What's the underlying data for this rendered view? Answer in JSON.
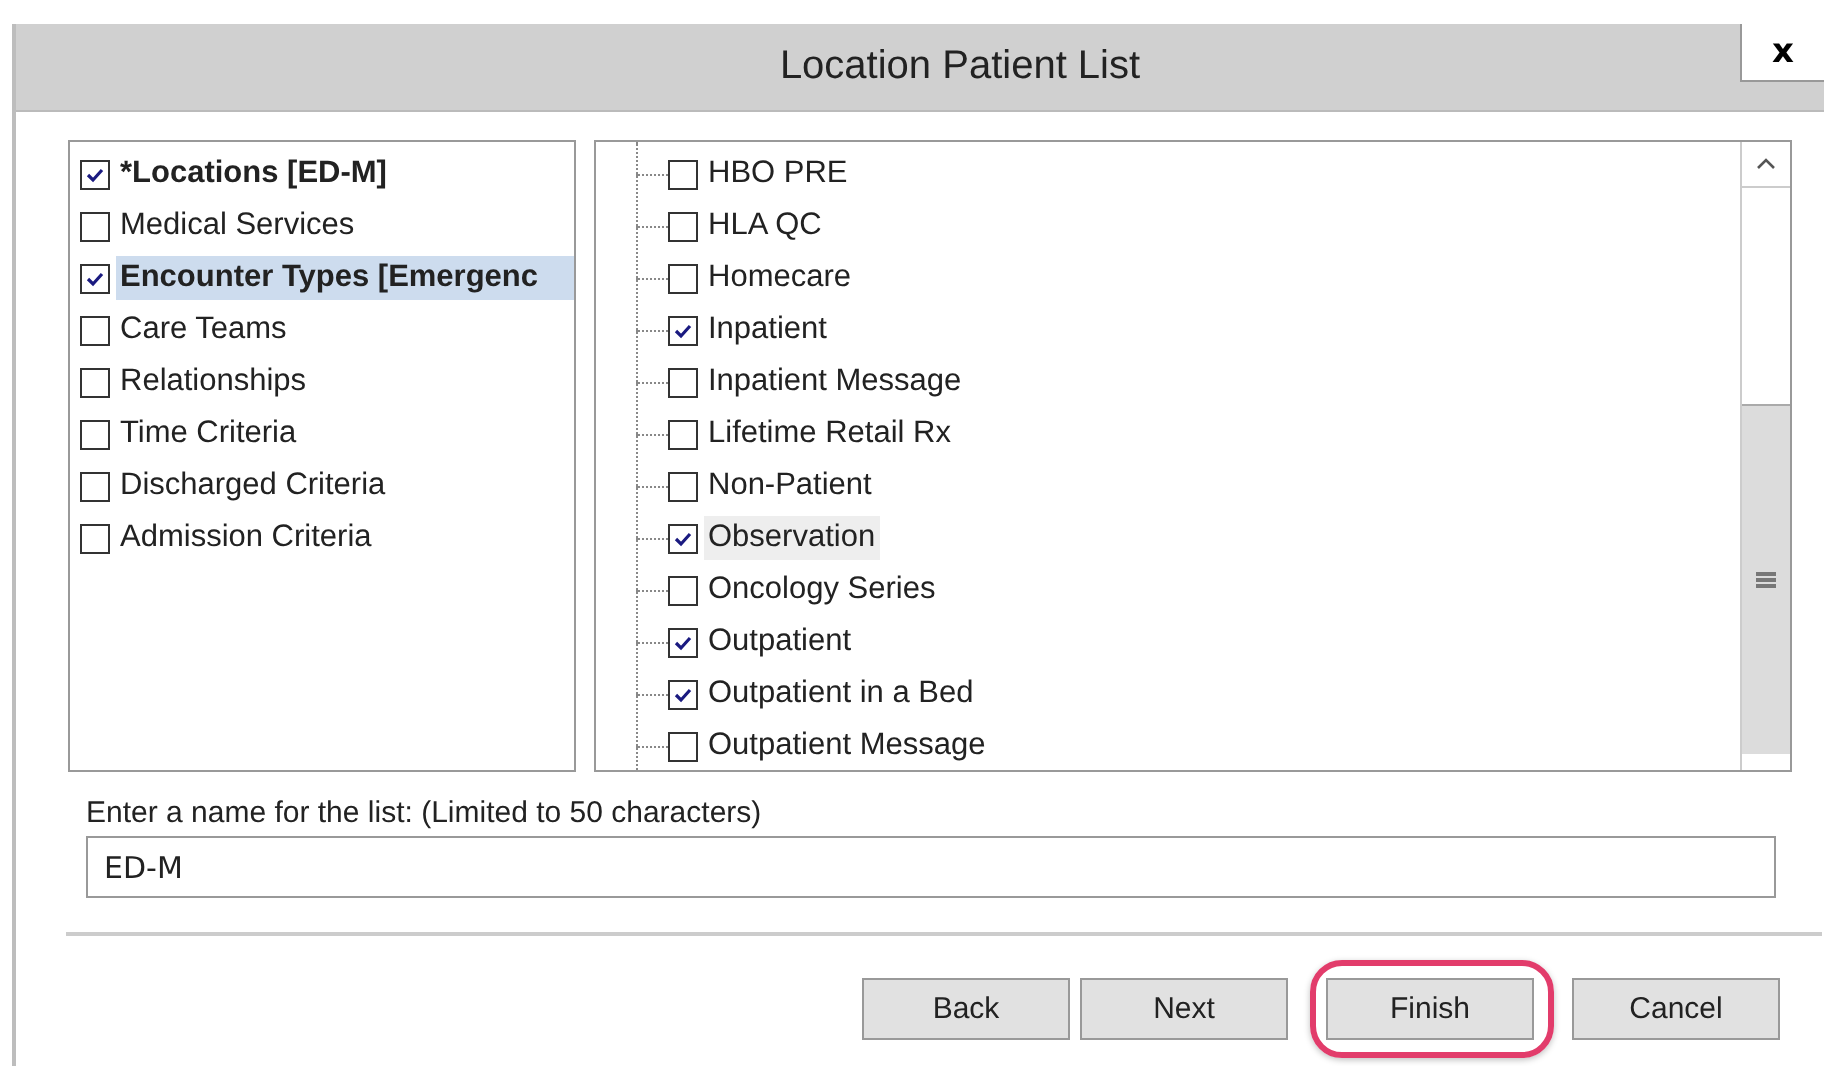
{
  "window": {
    "title": "Location Patient List",
    "close": "x"
  },
  "categories": [
    {
      "label": "*Locations [ED-M]",
      "checked": true,
      "bold": true,
      "selected": false
    },
    {
      "label": "Medical Services",
      "checked": false,
      "bold": false,
      "selected": false
    },
    {
      "label": "Encounter Types [Emergenc",
      "checked": true,
      "bold": true,
      "selected": true
    },
    {
      "label": "Care Teams",
      "checked": false,
      "bold": false,
      "selected": false
    },
    {
      "label": "Relationships",
      "checked": false,
      "bold": false,
      "selected": false
    },
    {
      "label": "Time Criteria",
      "checked": false,
      "bold": false,
      "selected": false
    },
    {
      "label": "Discharged Criteria",
      "checked": false,
      "bold": false,
      "selected": false
    },
    {
      "label": "Admission Criteria",
      "checked": false,
      "bold": false,
      "selected": false
    }
  ],
  "options": [
    {
      "label": "HBO PRE",
      "checked": false,
      "selected": false
    },
    {
      "label": "HLA QC",
      "checked": false,
      "selected": false
    },
    {
      "label": "Homecare",
      "checked": false,
      "selected": false
    },
    {
      "label": "Inpatient",
      "checked": true,
      "selected": false
    },
    {
      "label": "Inpatient Message",
      "checked": false,
      "selected": false
    },
    {
      "label": "Lifetime Retail Rx",
      "checked": false,
      "selected": false
    },
    {
      "label": "Non-Patient",
      "checked": false,
      "selected": false
    },
    {
      "label": "Observation",
      "checked": true,
      "selected": true
    },
    {
      "label": "Oncology Series",
      "checked": false,
      "selected": false
    },
    {
      "label": "Outpatient",
      "checked": true,
      "selected": false
    },
    {
      "label": "Outpatient in a Bed",
      "checked": true,
      "selected": false
    },
    {
      "label": "Outpatient Message",
      "checked": false,
      "selected": false
    }
  ],
  "name_field": {
    "label": "Enter a name for the list: (Limited to 50 characters)",
    "value": "ED-M"
  },
  "buttons": [
    {
      "label": "Back",
      "highlighted": false
    },
    {
      "label": "Next",
      "highlighted": false
    },
    {
      "label": "Finish",
      "highlighted": true
    },
    {
      "label": "Cancel",
      "highlighted": false
    }
  ]
}
